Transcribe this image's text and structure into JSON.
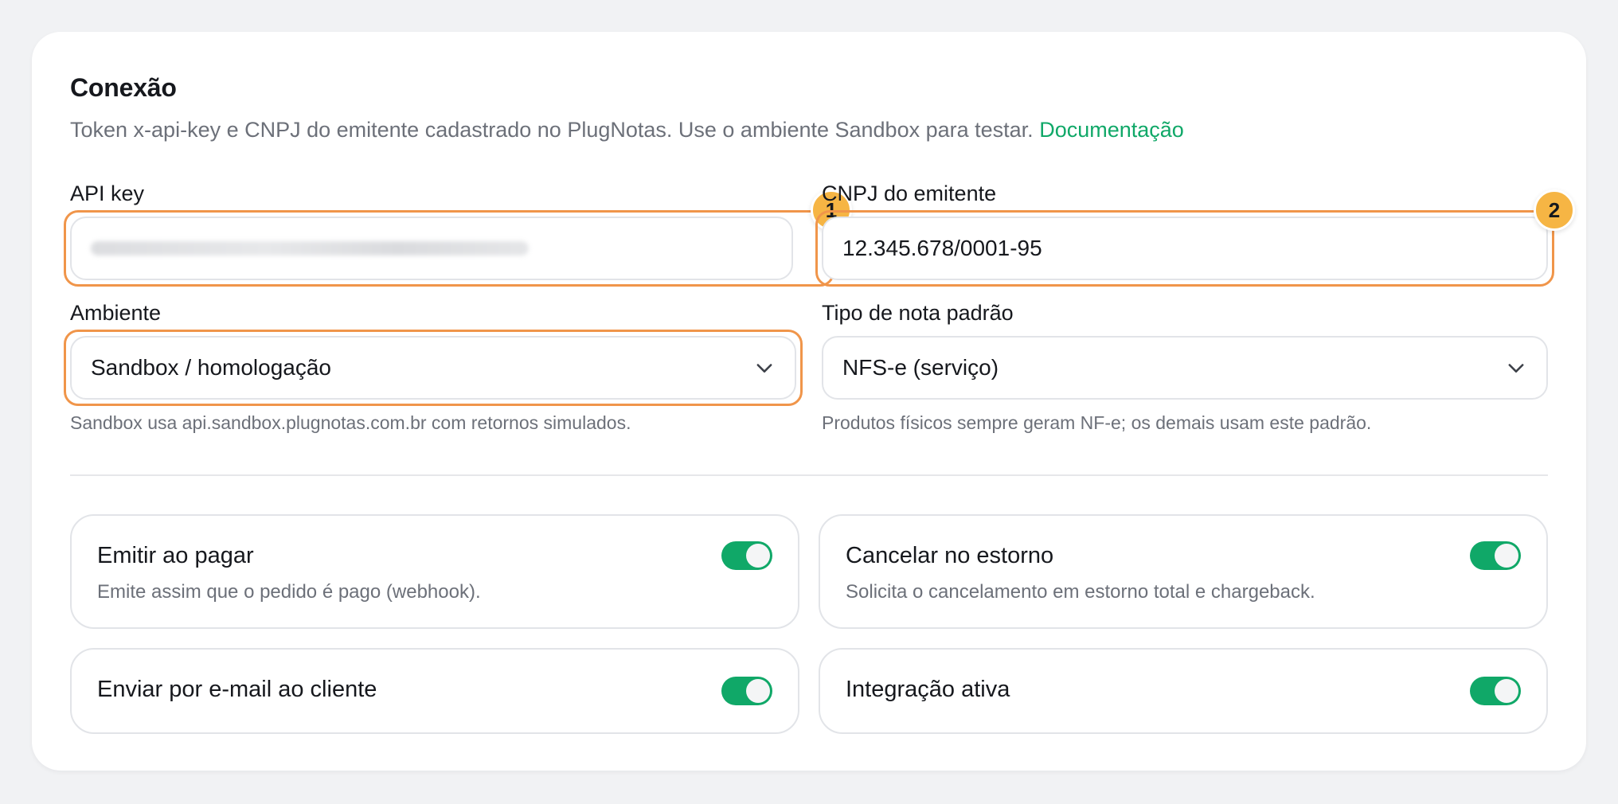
{
  "section": {
    "title": "Conexão",
    "subtitle": "Token x-api-key e CNPJ do emitente cadastrado no PlugNotas. Use o ambiente Sandbox para testar.",
    "doc_link": "Documentação"
  },
  "fields": {
    "api_key": {
      "label": "API key",
      "badge": "1"
    },
    "cnpj": {
      "label": "CNPJ do emitente",
      "value": "12.345.678/0001-95",
      "badge": "2"
    },
    "ambiente": {
      "label": "Ambiente",
      "value": "Sandbox / homologação",
      "hint": "Sandbox usa api.sandbox.plugnotas.com.br com retornos simulados."
    },
    "tipo_nota": {
      "label": "Tipo de nota padrão",
      "value": "NFS-e (serviço)",
      "hint": "Produtos físicos sempre geram NF-e; os demais usam este padrão."
    }
  },
  "options": [
    {
      "title": "Emitir ao pagar",
      "description": "Emite assim que o pedido é pago (webhook).",
      "enabled": true
    },
    {
      "title": "Cancelar no estorno",
      "description": "Solicita o cancelamento em estorno total e chargeback.",
      "enabled": true
    },
    {
      "title": "Enviar por e-mail ao cliente",
      "enabled": true
    },
    {
      "title": "Integração ativa",
      "enabled": true
    }
  ],
  "colors": {
    "accent": "#10a868",
    "highlight": "#f0954a",
    "badge": "#f6b544"
  }
}
